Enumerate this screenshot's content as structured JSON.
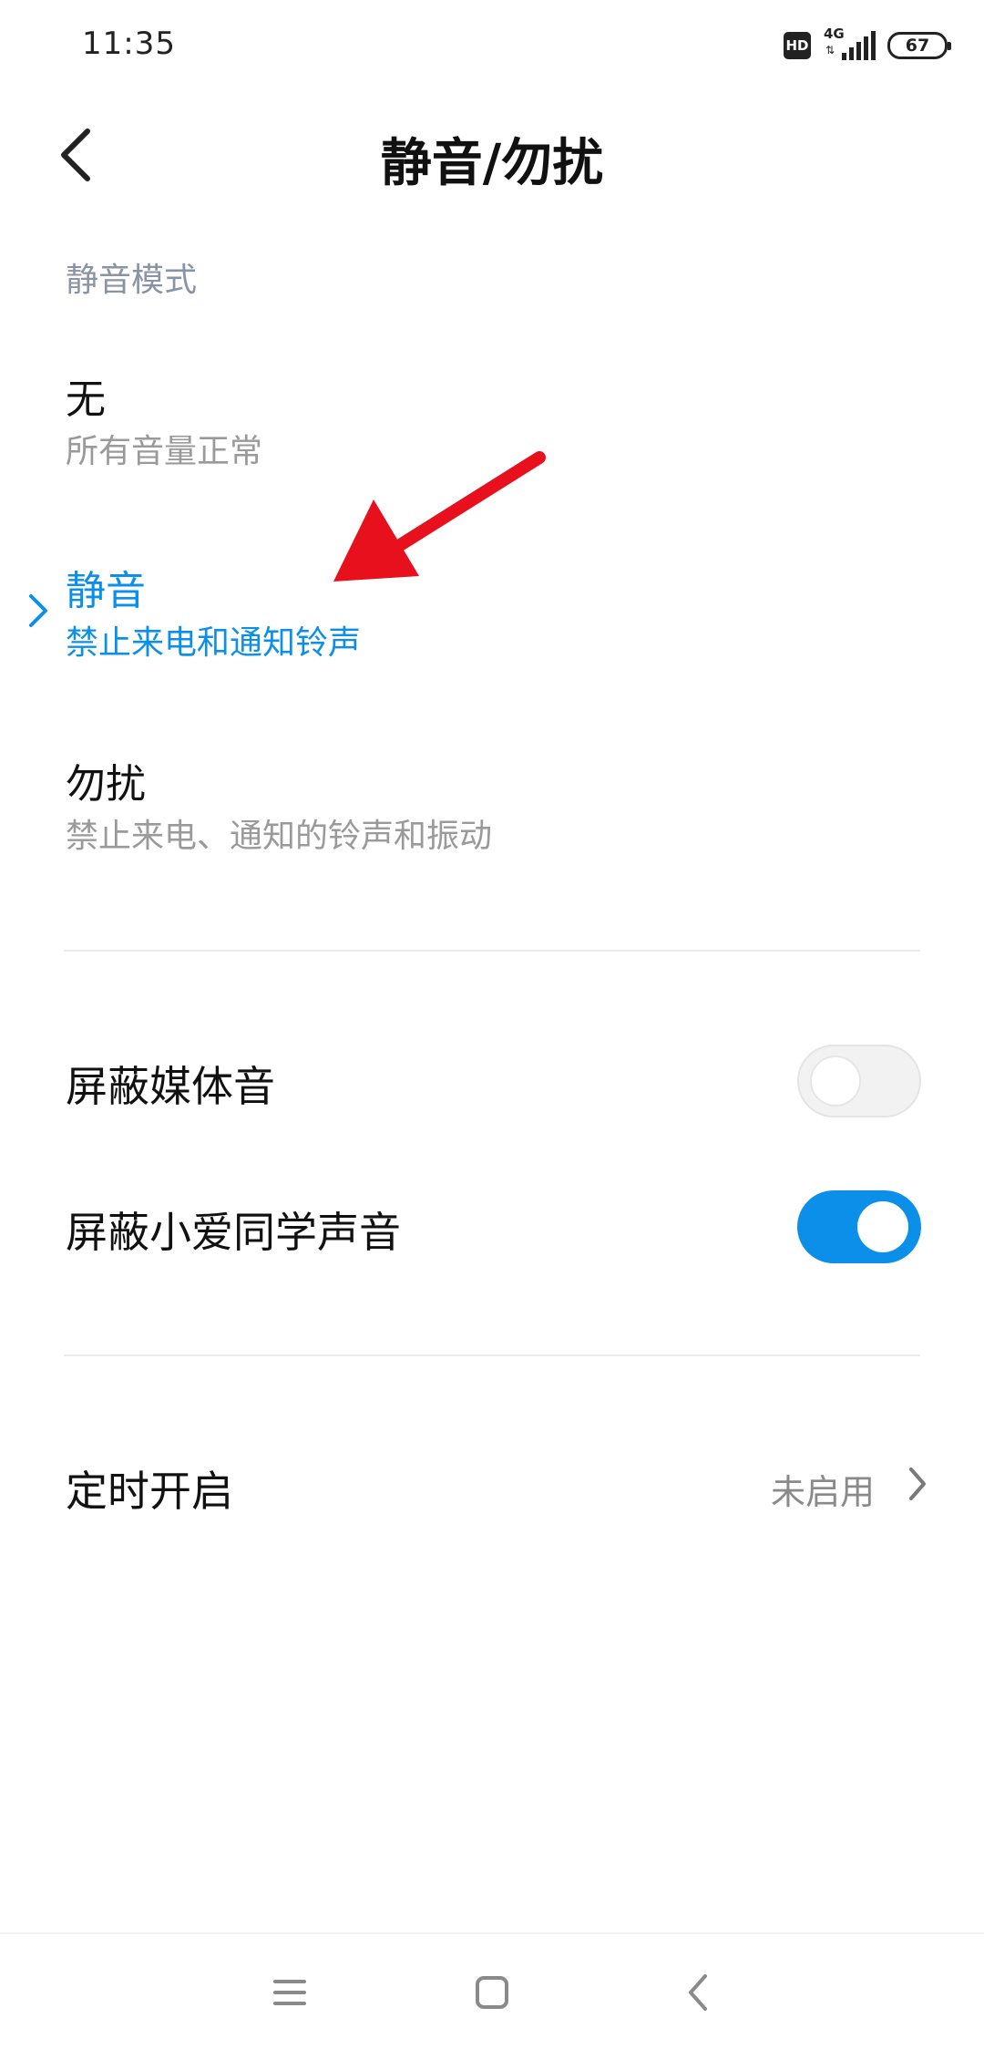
{
  "status": {
    "time": "11:35",
    "hd": "HD",
    "network": "4G",
    "battery": "67"
  },
  "header": {
    "title": "静音/勿扰"
  },
  "section": {
    "title": "静音模式"
  },
  "modes": [
    {
      "title": "无",
      "subtitle": "所有音量正常",
      "selected": false
    },
    {
      "title": "静音",
      "subtitle": "禁止来电和通知铃声",
      "selected": true
    },
    {
      "title": "勿扰",
      "subtitle": "禁止来电、通知的铃声和振动",
      "selected": false
    }
  ],
  "toggles": [
    {
      "label": "屏蔽媒体音",
      "on": false
    },
    {
      "label": "屏蔽小爱同学声音",
      "on": true
    }
  ],
  "timer": {
    "label": "定时开启",
    "value": "未启用"
  },
  "colors": {
    "accent": "#0c8fe9",
    "annotation_arrow": "#e8101c"
  }
}
